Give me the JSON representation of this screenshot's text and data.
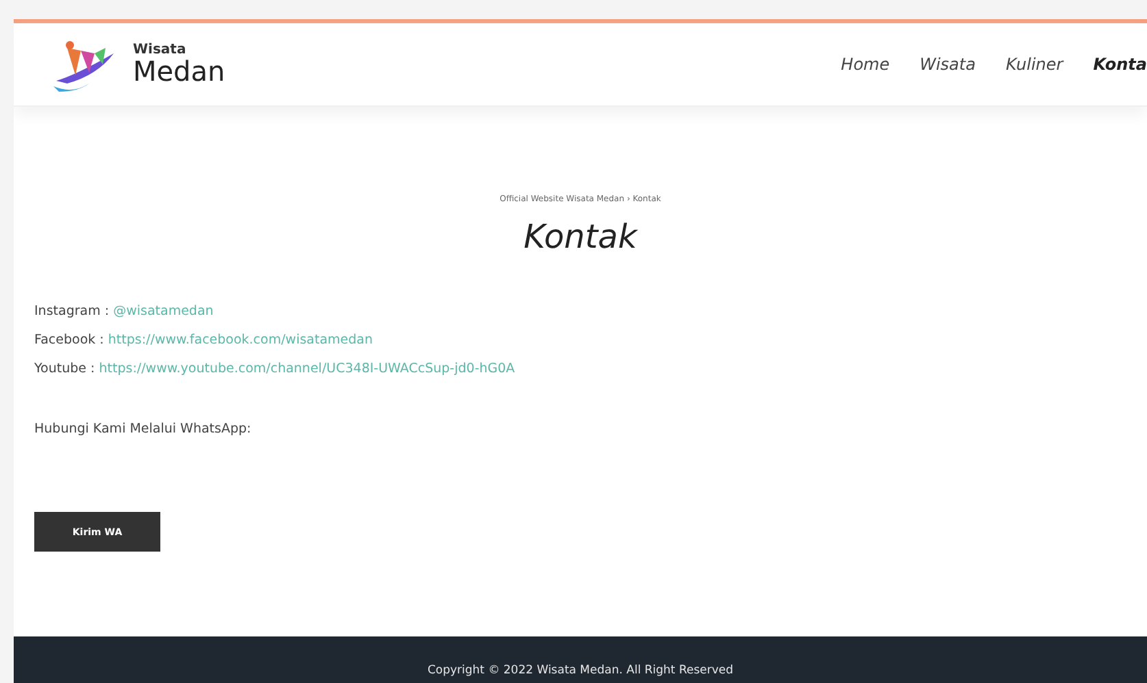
{
  "logo": {
    "small": "Wisata",
    "large": "Medan"
  },
  "nav": [
    {
      "label": "Home",
      "selected": false
    },
    {
      "label": "Wisata",
      "selected": false
    },
    {
      "label": "Kuliner",
      "selected": false
    },
    {
      "label": "Konta",
      "selected": true
    }
  ],
  "breadcrumb": "Official Website Wisata Medan › Kontak",
  "title": "Kontak",
  "contacts": [
    {
      "label": "Instagram :",
      "link": "@wisatamedan"
    },
    {
      "label": "Facebook :",
      "link": "https://www.facebook.com/wisatamedan"
    },
    {
      "label": "Youtube :",
      "link": "https://www.youtube.com/channel/UC348I-UWACcSup-jd0-hG0A"
    }
  ],
  "whatsapp_text": "Hubungi Kami Melalui WhatsApp:",
  "button": "Kirim WA",
  "footer": "Copyright © 2022 Wisata Medan. All Right Reserved"
}
